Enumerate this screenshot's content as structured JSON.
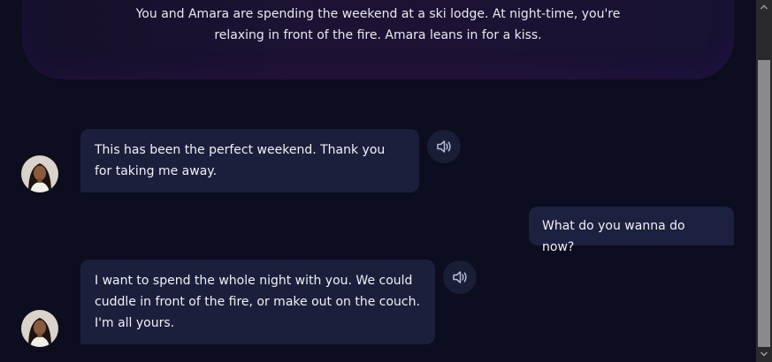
{
  "scenario": {
    "text": "You and Amara are spending the weekend at a ski lodge. At night-time, you're relaxing in front of the fire. Amara leans in for a kiss."
  },
  "messages": [
    {
      "sender": "Amara",
      "text": "This has been the perfect weekend. Thank you for taking me away."
    },
    {
      "sender": "user",
      "text": "What do you wanna do now?"
    },
    {
      "sender": "Amara",
      "text": "I want to spend the whole night with you. We could cuddle in front of the fire, or make out on the couch. I'm all yours."
    }
  ],
  "icons": {
    "speaker": "speaker-icon",
    "avatar": "avatar"
  },
  "colors": {
    "background": "#0c0d1f",
    "bubble": "#1b1f3c",
    "scenario": "#1d1233"
  }
}
